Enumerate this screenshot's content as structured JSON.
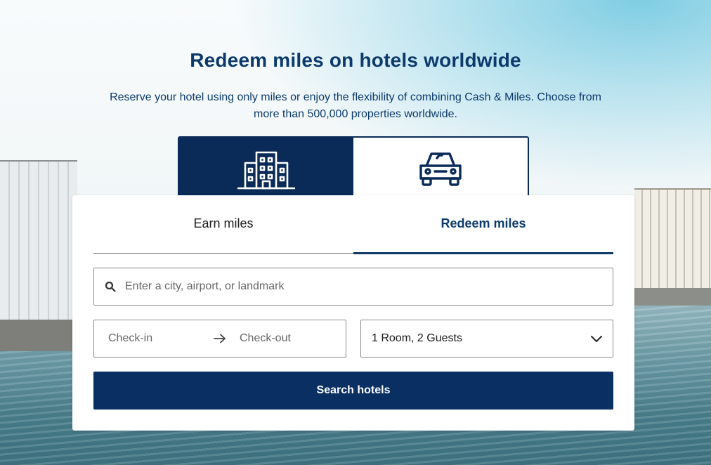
{
  "hero": {
    "title": "Redeem miles on hotels worldwide",
    "subtitle": "Reserve your hotel using only miles or enjoy the flexibility of combining Cash & Miles. Choose from more than 500,000 properties worldwide."
  },
  "type_tabs": [
    {
      "icon": "hotel-building-icon",
      "active": true
    },
    {
      "icon": "car-icon",
      "active": false
    }
  ],
  "mode_tabs": [
    {
      "label": "Earn miles",
      "active": false
    },
    {
      "label": "Redeem miles",
      "active": true
    }
  ],
  "search": {
    "icon": "search-icon",
    "placeholder": "Enter a city, airport, or landmark",
    "value": ""
  },
  "dates": {
    "checkin_label": "Check-in",
    "checkout_label": "Check-out",
    "arrow_icon": "arrow-right-icon"
  },
  "guests": {
    "value": "1 Room, 2 Guests",
    "icon": "chevron-down-icon"
  },
  "search_button": {
    "label": "Search hotels"
  },
  "colors": {
    "primary": "#0a2a57",
    "heading": "#0c3a6b"
  }
}
